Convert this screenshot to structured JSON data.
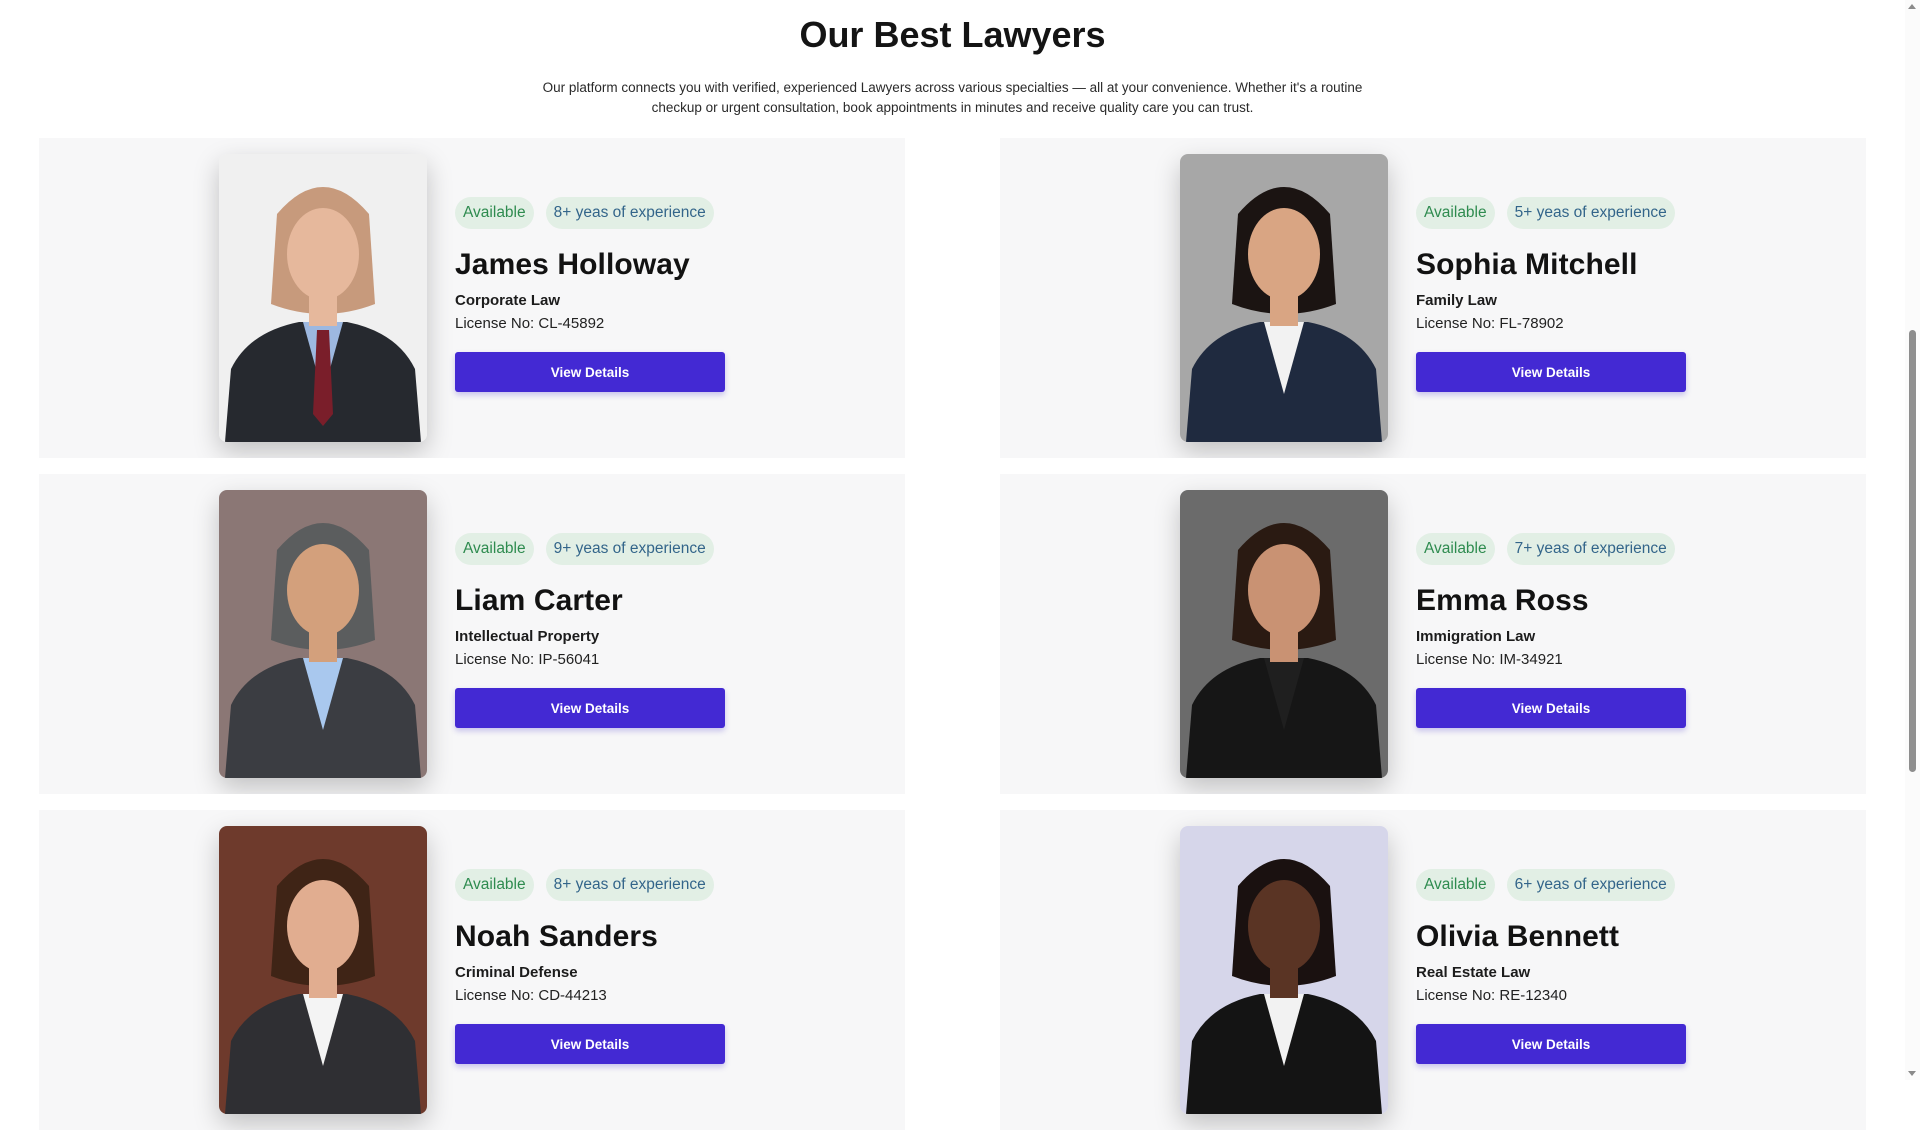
{
  "section": {
    "title": "Our Best Lawyers",
    "description": "Our platform connects you with verified, experienced Lawyers across various specialties — all at your convenience. Whether it's a routine checkup or urgent consultation, book appointments in minutes and receive quality care you can trust."
  },
  "colors": {
    "accent": "#4329d3",
    "card_bg": "#f7f7f8",
    "badge_bg": "#e2efe5",
    "available_text": "#2e8b4f",
    "experience_text": "#33658a"
  },
  "lawyers": [
    {
      "status": "Available",
      "experience": "8+ yeas of experience",
      "name": "James Holloway",
      "practice": "Corporate Law",
      "license": "License No: CL-45892",
      "button": "View Details",
      "photo": {
        "bg": "#f0f0f0",
        "skin": "#e6b89c",
        "hair": "#c79a7c",
        "suit": "#26292f",
        "shirt": "#9db8e0",
        "tie": "#7a1e2a"
      }
    },
    {
      "status": "Available",
      "experience": "5+ yeas of experience",
      "name": "Sophia Mitchell",
      "practice": "Family Law",
      "license": "License No: FL-78902",
      "button": "View Details",
      "photo": {
        "bg": "#a7a7a7",
        "skin": "#d9a583",
        "hair": "#1b1412",
        "suit": "#1f2a3f",
        "shirt": "#f2f2f2",
        "tie": ""
      }
    },
    {
      "status": "Available",
      "experience": "9+ yeas of experience",
      "name": "Liam Carter",
      "practice": "Intellectual Property",
      "license": "License No: IP-56041",
      "button": "View Details",
      "photo": {
        "bg": "#8b7775",
        "skin": "#d3a07c",
        "hair": "#5b5d5e",
        "suit": "#3b3d42",
        "shirt": "#a9c8ee",
        "tie": ""
      }
    },
    {
      "status": "Available",
      "experience": "7+ yeas of experience",
      "name": "Emma Ross",
      "practice": "Immigration Law",
      "license": "License No: IM-34921",
      "button": "View Details",
      "photo": {
        "bg": "#6b6b6b",
        "skin": "#c99273",
        "hair": "#2a1a12",
        "suit": "#161616",
        "shirt": "#1f1f1f",
        "tie": ""
      }
    },
    {
      "status": "Available",
      "experience": "8+ yeas of experience",
      "name": "Noah Sanders",
      "practice": "Criminal Defense",
      "license": "License No: CD-44213",
      "button": "View Details",
      "photo": {
        "bg": "#6e3a2c",
        "skin": "#e1ad90",
        "hair": "#3f2416",
        "suit": "#2f2f33",
        "shirt": "#f4f4f4",
        "tie": ""
      }
    },
    {
      "status": "Available",
      "experience": "6+ yeas of experience",
      "name": "Olivia Bennett",
      "practice": "Real Estate Law",
      "license": "License No: RE-12340",
      "button": "View Details",
      "photo": {
        "bg": "#d6d6ea",
        "skin": "#5a3424",
        "hair": "#1a1110",
        "suit": "#141414",
        "shirt": "#f2f2f2",
        "tie": ""
      }
    }
  ]
}
